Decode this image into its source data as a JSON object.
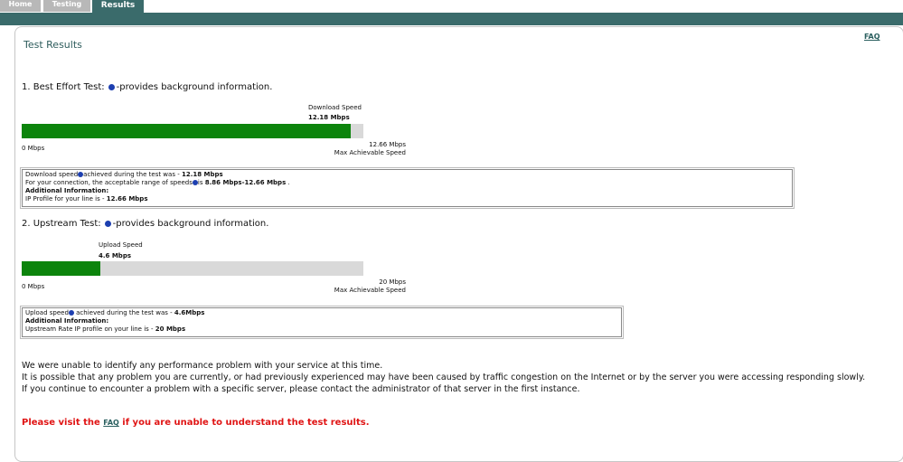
{
  "tabs": [
    {
      "label": "Home"
    },
    {
      "label": "Testing"
    },
    {
      "label": "Results"
    }
  ],
  "faq_link": "FAQ",
  "title": "Test Results",
  "best_effort": {
    "heading": "1. Best Effort Test:",
    "heading_suffix": "-provides background information.",
    "speed_label": "Download Speed",
    "speed_value": "12.18 Mbps",
    "progress_fraction": 0.962,
    "min_label": "0 Mbps",
    "max_value": "12.66 Mbps",
    "max_label": "Max Achievable Speed",
    "info_line1_a": "Download speed",
    "info_line1_b": "achieved during the test was - ",
    "info_line1_value": "12.18 Mbps",
    "info_line2_a": "For your connection, the acceptable range of speeds",
    "info_line2_b": "is ",
    "info_line2_value": "8.86 Mbps-12.66 Mbps",
    "info_line2_end": " .",
    "info_line3": "Additional Information:",
    "info_line4_a": "IP Profile for your line is - ",
    "info_line4_value": "12.66 Mbps"
  },
  "upstream": {
    "heading": "2. Upstream Test:",
    "heading_suffix": "-provides background information.",
    "speed_label": "Upload Speed",
    "speed_value": "4.6 Mbps",
    "progress_fraction": 0.23,
    "min_label": "0 Mbps",
    "max_value": "20 Mbps",
    "max_label": "Max Achievable Speed",
    "info_line1_a": "Upload speed",
    "info_line1_b": " achieved during the test was - ",
    "info_line1_value": "4.6Mbps",
    "info_line2": "Additional Information:",
    "info_line3_a": "Upstream Rate IP profile on your line is - ",
    "info_line3_value": "20 Mbps"
  },
  "message": {
    "line1": "We were unable to identify any performance problem with your service at this time.",
    "line2": "It is possible that any problem you are currently, or had previously experienced may have been caused by traffic congestion on the Internet or by the server you were accessing responding slowly.",
    "line3": "If you continue to encounter a problem with a specific server, please contact the administrator of that server in the first instance."
  },
  "visit": {
    "prefix": "Please visit the ",
    "link": "FAQ",
    "suffix": " if you are unable to understand the test results."
  },
  "colors": {
    "accent": "#3a6b6b",
    "bar_fill": "#0c840c",
    "warning": "#e01414"
  },
  "icons": {
    "info": "info-circle-icon"
  }
}
